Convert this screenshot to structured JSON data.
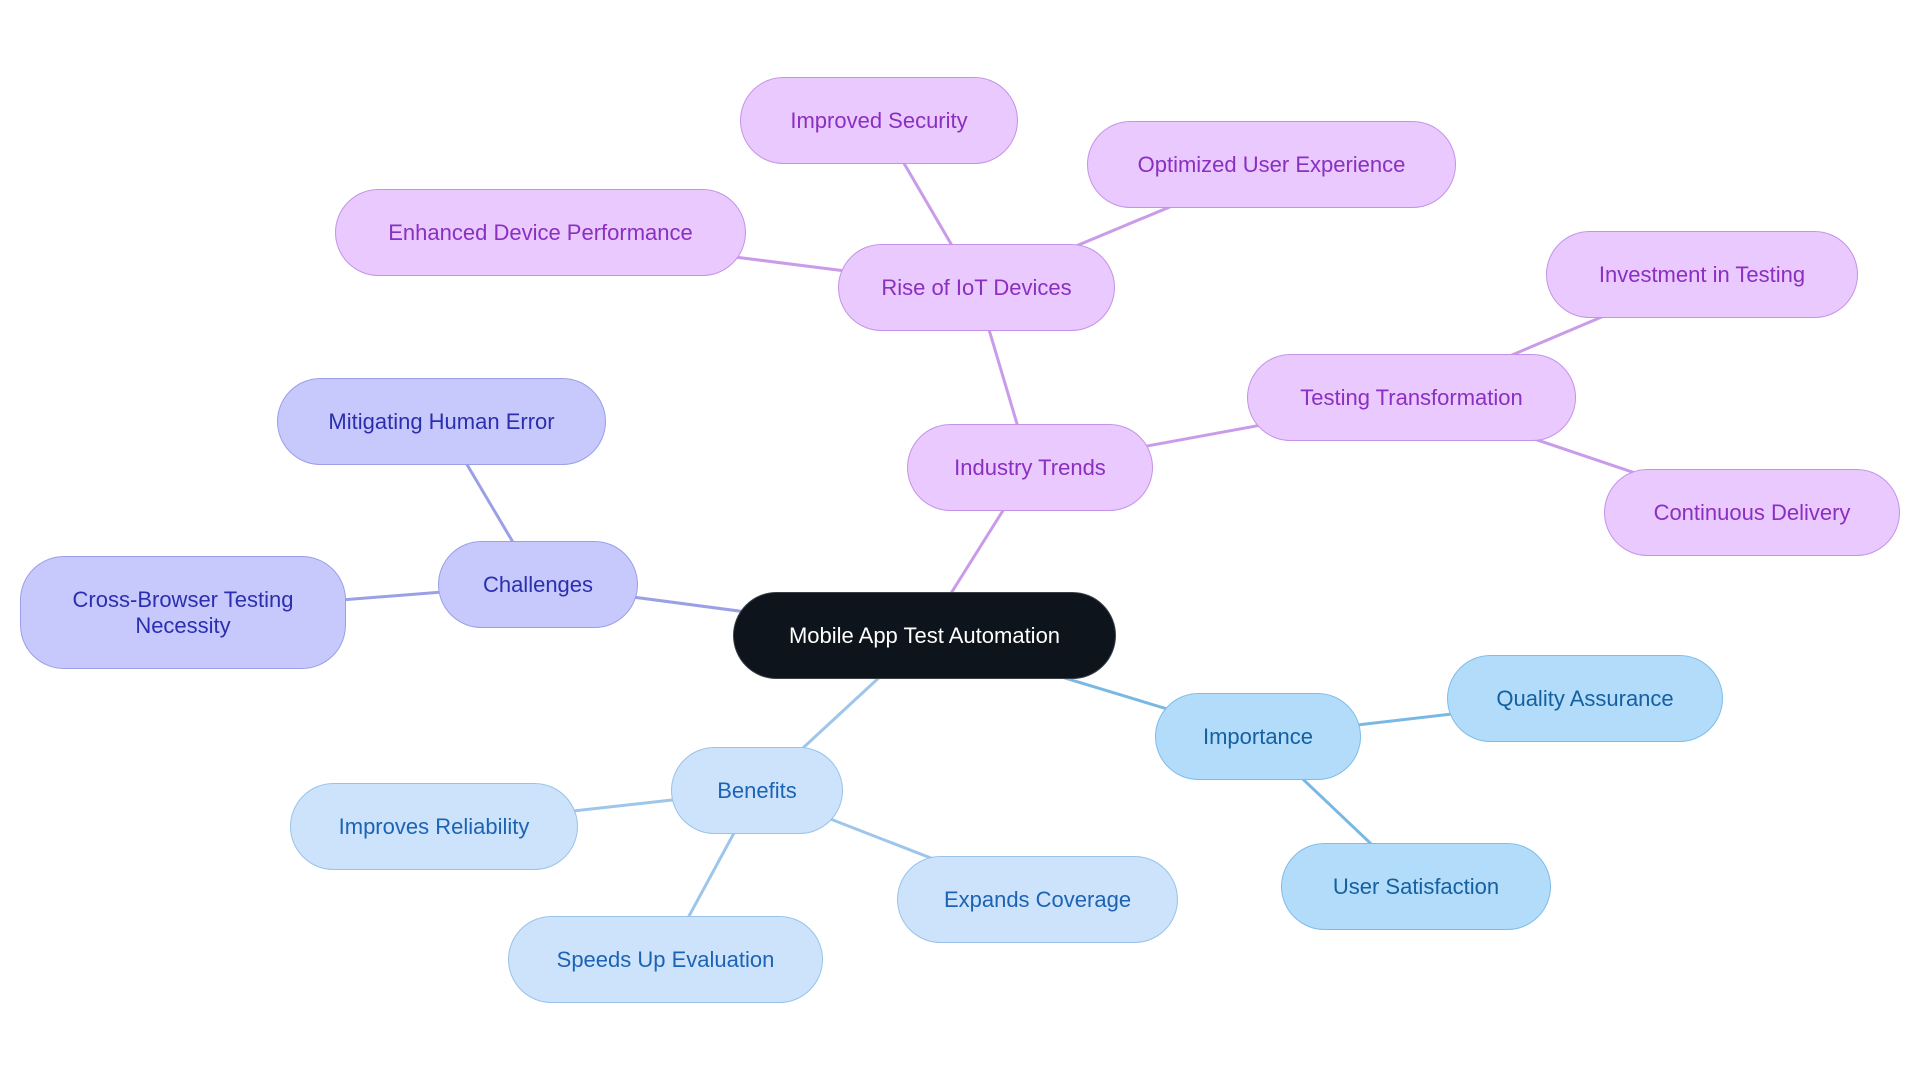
{
  "diagram": {
    "type": "mindmap",
    "root": "Mobile App Test Automation",
    "colors": {
      "root_fill": "#0d141b",
      "industry_fill": "#e9c9fe",
      "industry_edge": "#c99be9",
      "challenges_fill": "#c7c9fd",
      "challenges_edge": "#9aa0e6",
      "benefits_fill": "#cde3fb",
      "benefits_edge": "#9ec5ea",
      "importance_fill": "#b3dcfb",
      "importance_edge": "#7ab8e4"
    },
    "nodes": {
      "root": "Mobile App Test Automation",
      "industry_trends": "Industry Trends",
      "rise_iot": "Rise of IoT Devices",
      "improved_security": "Improved Security",
      "optimized_ux": "Optimized User Experience",
      "enhanced_performance": "Enhanced Device Performance",
      "testing_transformation": "Testing Transformation",
      "investment_testing": "Investment in Testing",
      "continuous_delivery": "Continuous Delivery",
      "challenges": "Challenges",
      "mitigating_error": "Mitigating Human Error",
      "cross_browser": "Cross-Browser Testing Necessity",
      "benefits": "Benefits",
      "improves_reliability": "Improves Reliability",
      "speeds_up": "Speeds Up Evaluation",
      "expands_coverage": "Expands Coverage",
      "importance": "Importance",
      "quality_assurance": "Quality Assurance",
      "user_satisfaction": "User Satisfaction"
    },
    "edges": [
      [
        "root",
        "industry_trends",
        "industry_edge"
      ],
      [
        "industry_trends",
        "rise_iot",
        "industry_edge"
      ],
      [
        "rise_iot",
        "improved_security",
        "industry_edge"
      ],
      [
        "rise_iot",
        "optimized_ux",
        "industry_edge"
      ],
      [
        "rise_iot",
        "enhanced_performance",
        "industry_edge"
      ],
      [
        "industry_trends",
        "testing_transformation",
        "industry_edge"
      ],
      [
        "testing_transformation",
        "investment_testing",
        "industry_edge"
      ],
      [
        "testing_transformation",
        "continuous_delivery",
        "industry_edge"
      ],
      [
        "root",
        "challenges",
        "challenges_edge"
      ],
      [
        "challenges",
        "mitigating_error",
        "challenges_edge"
      ],
      [
        "challenges",
        "cross_browser",
        "challenges_edge"
      ],
      [
        "root",
        "benefits",
        "benefits_edge"
      ],
      [
        "benefits",
        "improves_reliability",
        "benefits_edge"
      ],
      [
        "benefits",
        "speeds_up",
        "benefits_edge"
      ],
      [
        "benefits",
        "expands_coverage",
        "benefits_edge"
      ],
      [
        "root",
        "importance",
        "importance_edge"
      ],
      [
        "importance",
        "quality_assurance",
        "importance_edge"
      ],
      [
        "importance",
        "user_satisfaction",
        "importance_edge"
      ]
    ]
  }
}
